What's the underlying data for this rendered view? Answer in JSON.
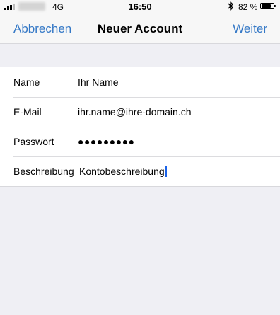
{
  "status_bar": {
    "network": "4G",
    "time": "16:50",
    "battery_percent": "82 %",
    "battery_level": 0.82,
    "icons": [
      "signal-bars-icon",
      "bluetooth-icon",
      "battery-icon"
    ]
  },
  "nav": {
    "cancel_label": "Abbrechen",
    "title": "Neuer Account",
    "next_label": "Weiter"
  },
  "form": {
    "rows": [
      {
        "label": "Name",
        "value": "Ihr Name"
      },
      {
        "label": "E-Mail",
        "value": "ihr.name@ihre-domain.ch"
      },
      {
        "label": "Passwort",
        "value": "●●●●●●●●●"
      },
      {
        "label": "Beschreibung",
        "value": "Kontobeschreibung"
      }
    ]
  },
  "colors": {
    "accent": "#3478c6",
    "background": "#efeff4",
    "caret": "#1b63e8"
  }
}
